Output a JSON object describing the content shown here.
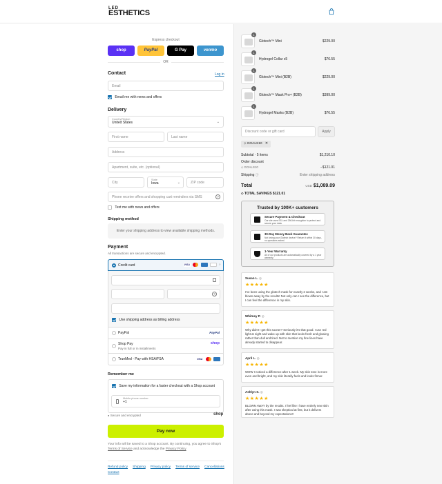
{
  "brand": {
    "line1": "LED",
    "line2": "ESTHETICS"
  },
  "express": {
    "title": "Express checkout",
    "buttons": [
      "shop",
      "PayPal",
      "G Pay",
      "venmo"
    ],
    "colors": [
      "#5a31f4",
      "#ffc439",
      "#000000",
      "#3d95ce"
    ],
    "or": "OR"
  },
  "contact": {
    "title": "Contact",
    "login": "Log in",
    "email_placeholder": "Email",
    "news_label": "Email me with news and offers"
  },
  "delivery": {
    "title": "Delivery",
    "country_label": "Country/Region",
    "country_value": "United States",
    "first_name": "First name",
    "last_name": "Last name",
    "address": "Address",
    "apartment": "Apartment, suite, etc. (optional)",
    "city": "City",
    "state_label": "State",
    "state_value": "Iowa",
    "zip": "ZIP code",
    "phone": "Phone receive offers and shopping cart reminders via SMS",
    "text_label": "Text me with news and offers"
  },
  "shipping_method": {
    "title": "Shipping method",
    "message": "Enter your shipping address to view available shipping methods."
  },
  "payment": {
    "title": "Payment",
    "subtitle": "All transactions are secure and encrypted.",
    "credit_card": "Credit card",
    "billing_label": "Use shipping address as billing address",
    "paypal": "PayPal",
    "paypal_logo": "PayPal",
    "shop_pay": "Shop Pay",
    "shop_pay_sub": "Pay in full or in installments",
    "shop_logo": "shop",
    "truemed": "TrueMed - Pay with HSA/FSA"
  },
  "remember": {
    "title": "Remember me",
    "save_label": "Save my information for a faster checkout with a Shop account",
    "mobile_label": "Mobile phone number",
    "mobile_value": "+1",
    "secure": "Secure and encrypted",
    "shop": "shop"
  },
  "pay_now": {
    "label": "Pay now",
    "color": "#ccf000"
  },
  "legal": {
    "text_before": "Your info will be saved to a Shop account. By continuing, you agree to Shop's",
    "terms": "Terms of Service",
    "and": "and acknowledge the",
    "privacy": "Privacy Policy"
  },
  "footer_links": [
    "Refund policy",
    "Shipping",
    "Privacy policy",
    "Terms of service",
    "Cancellations",
    "Contact"
  ],
  "cart_items": [
    {
      "qty": "1",
      "name": "Glotech™ Mini",
      "price": "$229.00"
    },
    {
      "qty": "1",
      "name": "Hydrogel Collar x5",
      "price": "$76.55"
    },
    {
      "qty": "1",
      "name": "Glotech™ Mini (B2B)",
      "price": "$229.00"
    },
    {
      "qty": "1",
      "name": "Glotech™ Mask Pro+ (B2B)",
      "price": "$399.00"
    },
    {
      "qty": "1",
      "name": "Hydrogel Masks (B2B)",
      "price": "$76.55"
    }
  ],
  "discount": {
    "placeholder": "Discount code or gift card",
    "apply": "Apply",
    "code": "GOALS10"
  },
  "summary": {
    "subtotal_label": "Subtotal · 5 items",
    "subtotal": "$1,210.10",
    "order_discount": "Order discount",
    "code": "GOALS10",
    "discount_value": "−$121.01",
    "shipping_label": "Shipping",
    "shipping_value": "Enter shipping address",
    "total_label": "Total",
    "currency": "USD",
    "total": "$1,089.09",
    "savings": "TOTAL SAVINGS  $121.01"
  },
  "trust": {
    "title": "Trusted by 100K+ customers",
    "badges": [
      {
        "title": "Secure Payment & Checkout",
        "sub": "Our site uses SSL and 256-bit encryption to protect and secure your data."
      },
      {
        "title": "30-Day Money Back Guarantee",
        "sub": "Not loving your Glotech device? Return it within 30 days, no questions asked."
      },
      {
        "title": "1-Year Warranty",
        "sub": "All of our products are automatically covered by a 1 year warranty."
      }
    ]
  },
  "reviews": [
    {
      "name": "Susan L.",
      "stars": "★★★★★",
      "text": "I've been using the glotech mask for exactly 2 weeks, and I am blown away by the results! Not only can I see the difference, but I can feel the difference in my skin."
    },
    {
      "name": "Whitney P.",
      "stars": "★★★★★",
      "text": "Why didn't I get this sooner? Seriously it's that good. I use red light at night and wake up with skin that looks fresh and glowing rather than dull and tired. Not to mention my fine lines have already started to disappear."
    },
    {
      "name": "April L.",
      "stars": "★★★★★",
      "text": "WOW I noticed a difference after 1 week. My skin tone is more even and bright, and my skin literally feels and looks firmer."
    },
    {
      "name": "Ashlyn S.",
      "stars": "★★★★★",
      "text": "BLOWN AWAY by the results. I feel like I have entirely new skin after using this mask. I was skeptical at first, but it delivers above and beyond my expectations!!"
    }
  ]
}
